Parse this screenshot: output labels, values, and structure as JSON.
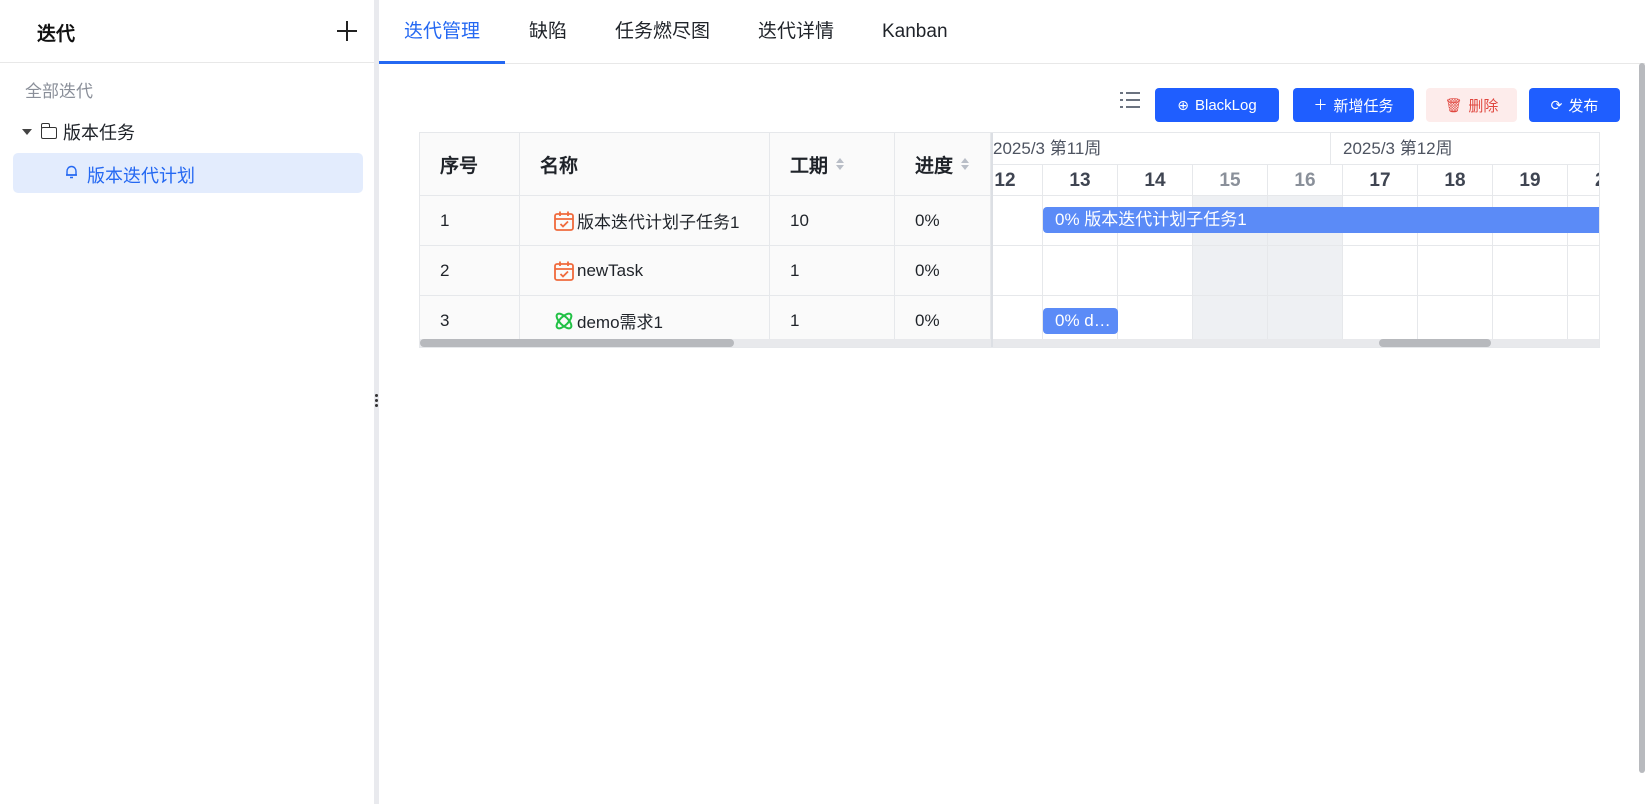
{
  "sidebar": {
    "title": "迭代",
    "all_label": "全部迭代",
    "group_label": "版本任务",
    "item_label": "版本迭代计划"
  },
  "tabs": [
    "迭代管理",
    "缺陷",
    "任务燃尽图",
    "迭代详情",
    "Kanban"
  ],
  "active_tab": 0,
  "toolbar": {
    "blacklog_label": "BlackLog",
    "add_task_label": "新增任务",
    "delete_label": "删除",
    "publish_label": "发布"
  },
  "table": {
    "headers": {
      "index": "序号",
      "name": "名称",
      "duration": "工期",
      "progress": "进度"
    },
    "rows": [
      {
        "index": "1",
        "icon": "calendar-check-icon",
        "name": "版本迭代计划子任务1",
        "duration": "10",
        "progress": "0%"
      },
      {
        "index": "2",
        "icon": "calendar-check-icon",
        "name": "newTask",
        "duration": "1",
        "progress": "0%"
      },
      {
        "index": "3",
        "icon": "requirement-icon",
        "name": "demo需求1",
        "duration": "1",
        "progress": "0%"
      }
    ]
  },
  "gantt": {
    "weeks": [
      "2025/3 第11周",
      "2025/3 第12周"
    ],
    "days": [
      "12",
      "13",
      "14",
      "15",
      "16",
      "17",
      "18",
      "19",
      "2"
    ],
    "weekend_days": [
      "15",
      "16"
    ],
    "bars": [
      {
        "label": "0% 版本迭代计划子任务1"
      },
      {
        "label": "0% d…"
      }
    ]
  },
  "colors": {
    "accent": "#2468f2",
    "button_primary": "#1f5eff",
    "bar": "#5b8bf7",
    "danger": "#e0473f",
    "task_icon": "#f06a3c",
    "requirement_icon": "#21c145"
  }
}
